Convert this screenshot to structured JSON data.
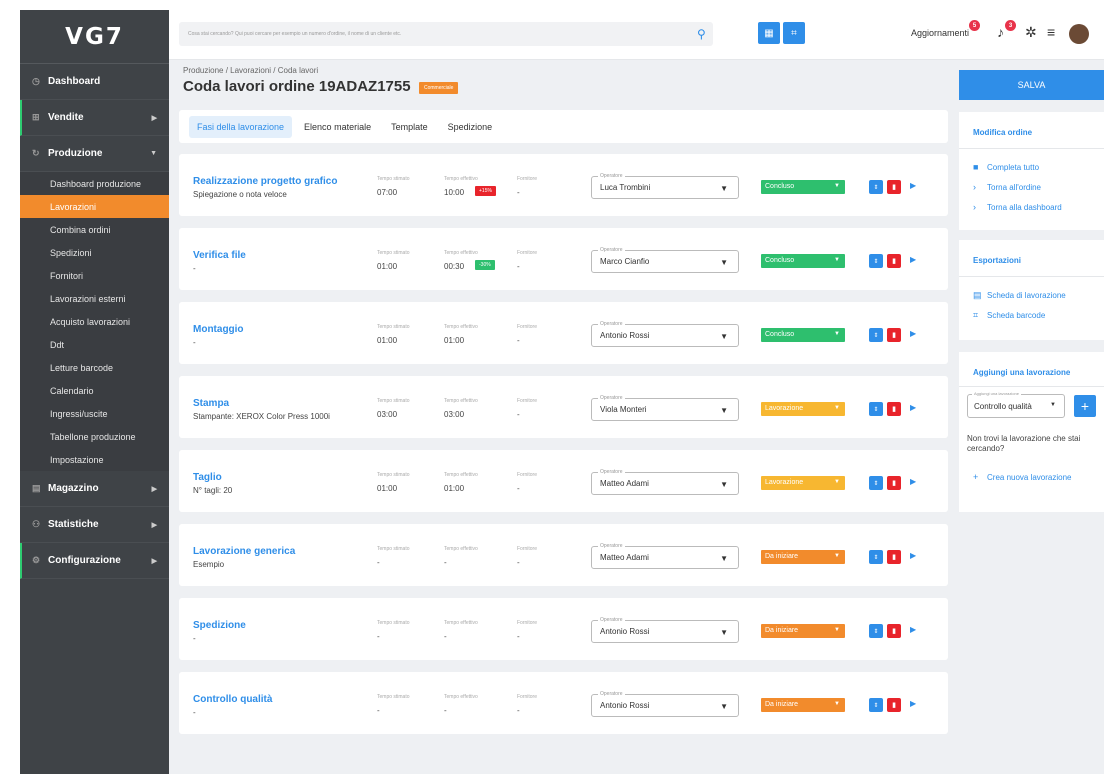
{
  "logo": "VG7",
  "sidebar": {
    "items": [
      {
        "label": "Dashboard"
      },
      {
        "label": "Vendite"
      },
      {
        "label": "Produzione"
      },
      {
        "label": "Magazzino"
      },
      {
        "label": "Statistiche"
      },
      {
        "label": "Configurazione"
      }
    ],
    "sub_items": [
      "Dashboard produzione",
      "Lavorazioni",
      "Combina ordini",
      "Spedizioni",
      "Fornitori",
      "Lavorazioni esterni",
      "Acquisto lavorazioni",
      "Ddt",
      "Letture barcode",
      "Calendario",
      "Ingressi/uscite",
      "Tabellone produzione",
      "Impostazione"
    ]
  },
  "topbar": {
    "search_placeholder": "Cosa stai cercando? Qui puoi cercare per esempio un numero d'ordine, il nome di un cliente etc.",
    "updates_label": "Aggiornamenti",
    "updates_badge": "5",
    "bell_badge": "3"
  },
  "header": {
    "breadcrumb": "Produzione / Lavorazioni / Coda lavori",
    "title": "Coda lavori ordine 19ADAZ1755",
    "tag": "Commerciale"
  },
  "tabs": [
    "Fasi della lavorazione",
    "Elenco materiale",
    "Template",
    "Spedizione"
  ],
  "columns": {
    "tempo_stimato": "Tempo stimato",
    "tempo_effettivo": "Tempo effettivo",
    "fornitore": "Fornitore",
    "operatore": "Operatore"
  },
  "works": [
    {
      "name": "Realizzazione progetto grafico",
      "note": "Spiegazione o nota veloce",
      "stimato": "07:00",
      "effettivo": "10:00",
      "effettivo_badge": "+15%",
      "badge_color": "#e8242b",
      "fornitore": "-",
      "operatore": "Luca Trombini",
      "status": "Concluso",
      "status_color": "#2ebf6e"
    },
    {
      "name": "Verifica file",
      "note": "-",
      "stimato": "01:00",
      "effettivo": "00:30",
      "effettivo_badge": "-30%",
      "badge_color": "#2ebf6e",
      "fornitore": "-",
      "operatore": "Marco Cianfio",
      "status": "Concluso",
      "status_color": "#2ebf6e"
    },
    {
      "name": "Montaggio",
      "note": "-",
      "stimato": "01:00",
      "effettivo": "01:00",
      "effettivo_badge": "",
      "badge_color": "",
      "fornitore": "-",
      "operatore": "Antonio Rossi",
      "status": "Concluso",
      "status_color": "#2ebf6e"
    },
    {
      "name": "Stampa",
      "note": "Stampante: XEROX Color Press 1000i",
      "stimato": "03:00",
      "effettivo": "03:00",
      "effettivo_badge": "",
      "badge_color": "",
      "fornitore": "-",
      "operatore": "Viola Monteri",
      "status": "Lavorazione",
      "status_color": "#f7b731"
    },
    {
      "name": "Taglio",
      "note": "N° tagli: 20",
      "stimato": "01:00",
      "effettivo": "01:00",
      "effettivo_badge": "",
      "badge_color": "",
      "fornitore": "-",
      "operatore": "Matteo Adami",
      "status": "Lavorazione",
      "status_color": "#f7b731"
    },
    {
      "name": "Lavorazione generica",
      "note": "Esempio",
      "stimato": "-",
      "effettivo": "-",
      "effettivo_badge": "",
      "badge_color": "",
      "fornitore": "-",
      "operatore": "Matteo Adami",
      "status": "Da iniziare",
      "status_color": "#f28b2c"
    },
    {
      "name": "Spedizione",
      "note": "-",
      "stimato": "-",
      "effettivo": "-",
      "effettivo_badge": "",
      "badge_color": "",
      "fornitore": "-",
      "operatore": "Antonio Rossi",
      "status": "Da iniziare",
      "status_color": "#f28b2c"
    },
    {
      "name": "Controllo qualità",
      "note": "-",
      "stimato": "-",
      "effettivo": "-",
      "effettivo_badge": "",
      "badge_color": "",
      "fornitore": "-",
      "operatore": "Antonio Rossi",
      "status": "Da iniziare",
      "status_color": "#f28b2c"
    }
  ],
  "right": {
    "save": "SALVA",
    "modifica_title": "Modifica ordine",
    "modifica_links": [
      "Completa tutto",
      "Torna all'ordine",
      "Torna alla dashboard"
    ],
    "esport_title": "Esportazioni",
    "esport_links": [
      "Scheda di lavorazione",
      "Scheda barcode"
    ],
    "add_title": "Aggiungi una lavorazione",
    "add_select_label": "Aggiungi una lavorazione",
    "add_select_value": "Controllo qualità",
    "add_text": "Non trovi la lavorazione che stai cercando?",
    "add_link": "Crea nuova lavorazione"
  }
}
